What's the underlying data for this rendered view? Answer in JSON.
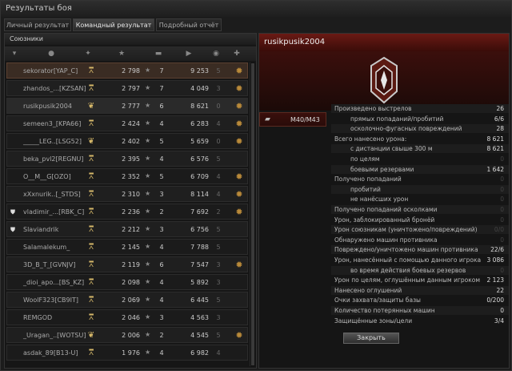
{
  "window": {
    "title": "Результаты боя"
  },
  "tabs": [
    {
      "label": "Личный результат"
    },
    {
      "label": "Командный результат"
    },
    {
      "label": "Подробный отчёт"
    }
  ],
  "team": {
    "title": "Союзники",
    "columns": [
      "rank-icon",
      "player-icon",
      "medal-icon",
      "xp-star-icon",
      "kills-icon",
      "damage-icon",
      "spot-icon",
      "badge-icon"
    ],
    "rows": [
      {
        "name": "sekorator[YAP_C]",
        "xp": "2 798",
        "kills": "7",
        "damage": "9 253",
        "spot": "5",
        "medal": "rank",
        "badge": true,
        "state": "selected"
      },
      {
        "name": "zhandos_...[KZSAN]",
        "xp": "2 797",
        "kills": "7",
        "damage": "4 049",
        "spot": "3",
        "medal": "rank",
        "badge": true,
        "state": ""
      },
      {
        "name": "rusikpusik2004",
        "xp": "2 777",
        "kills": "6",
        "damage": "8 621",
        "spot": "0",
        "medal": "wreath",
        "badge": true,
        "state": "me"
      },
      {
        "name": "semeen3_[KPA66]",
        "xp": "2 424",
        "kills": "4",
        "damage": "6 283",
        "spot": "4",
        "medal": "rank",
        "badge": true,
        "state": ""
      },
      {
        "name": "_____LEG..[LSG52]",
        "xp": "2 402",
        "kills": "5",
        "damage": "5 659",
        "spot": "0",
        "medal": "wreath",
        "badge": true,
        "state": ""
      },
      {
        "name": "beka_pvl2[REGNU]",
        "xp": "2 395",
        "kills": "4",
        "damage": "6 576",
        "spot": "5",
        "medal": "rank",
        "badge": false,
        "state": ""
      },
      {
        "name": "O__M__G[OZO]",
        "xp": "2 352",
        "kills": "5",
        "damage": "6 709",
        "spot": "4",
        "medal": "rank",
        "badge": true,
        "state": ""
      },
      {
        "name": "xXxnurik..[_STDS]",
        "xp": "2 310",
        "kills": "3",
        "damage": "8 114",
        "spot": "4",
        "medal": "rank",
        "badge": true,
        "state": ""
      },
      {
        "name": "vladimir_...[RBK_C]",
        "xp": "2 236",
        "kills": "2",
        "damage": "7 692",
        "spot": "2",
        "medal": "rank",
        "badge": true,
        "state": "",
        "tank": "shield"
      },
      {
        "name": "Slaviandrik",
        "xp": "2 212",
        "kills": "3",
        "damage": "6 756",
        "spot": "5",
        "medal": "rank",
        "badge": false,
        "state": "",
        "tank": "shield"
      },
      {
        "name": "Salamalekum_",
        "xp": "2 145",
        "kills": "4",
        "damage": "7 788",
        "spot": "5",
        "medal": "rank",
        "badge": false,
        "state": ""
      },
      {
        "name": "3D_B_T_[GVNJV]",
        "xp": "2 119",
        "kills": "6",
        "damage": "7 547",
        "spot": "3",
        "medal": "rank",
        "badge": true,
        "state": ""
      },
      {
        "name": "_dioi_apo...[BS_KZ]",
        "xp": "2 098",
        "kills": "4",
        "damage": "5 892",
        "spot": "3",
        "medal": "rank",
        "badge": false,
        "state": ""
      },
      {
        "name": "WoolF323[CB9IT]",
        "xp": "2 069",
        "kills": "4",
        "damage": "6 445",
        "spot": "5",
        "medal": "rank",
        "badge": false,
        "state": ""
      },
      {
        "name": "REMGOD",
        "xp": "2 046",
        "kills": "3",
        "damage": "4 563",
        "spot": "3",
        "medal": "rank",
        "badge": false,
        "state": ""
      },
      {
        "name": "_Uragan_..[WOTSU]",
        "xp": "2 006",
        "kills": "2",
        "damage": "4 545",
        "spot": "5",
        "medal": "wreath",
        "badge": true,
        "state": ""
      },
      {
        "name": "asdak_89[B13-U]",
        "xp": "1 976",
        "kills": "4",
        "damage": "6 982",
        "spot": "4",
        "medal": "rank",
        "badge": false,
        "state": ""
      }
    ]
  },
  "player": {
    "name": "rusikpusik2004",
    "vehicle": "M40/M43",
    "stats": [
      {
        "label": "Произведено выстрелов",
        "value": "26",
        "indent": 0,
        "dim": false
      },
      {
        "label": "прямых попаданий/пробитий",
        "value": "6/6",
        "indent": 1,
        "dim": false
      },
      {
        "label": "осколочно-фугасных повреждений",
        "value": "28",
        "indent": 1,
        "dim": false
      },
      {
        "label": "Всего нанесено урона:",
        "value": "8 621",
        "indent": 0,
        "dim": false
      },
      {
        "label": "с дистанции свыше 300 м",
        "value": "8 621",
        "indent": 1,
        "dim": false
      },
      {
        "label": "по целям",
        "value": "0",
        "indent": 1,
        "dim": true
      },
      {
        "label": "боевыми резервами",
        "value": "1 642",
        "indent": 1,
        "dim": false
      },
      {
        "label": "Получено попаданий",
        "value": "0",
        "indent": 0,
        "dim": true
      },
      {
        "label": "пробитий",
        "value": "0",
        "indent": 1,
        "dim": true
      },
      {
        "label": "не нанёсших урон",
        "value": "0",
        "indent": 1,
        "dim": true
      },
      {
        "label": "Получено попаданий осколками",
        "value": "0",
        "indent": 0,
        "dim": true
      },
      {
        "label": "Урон, заблокированный бронёй",
        "value": "0",
        "indent": 0,
        "dim": true
      },
      {
        "label": "Урон союзникам (уничтожено/повреждений)",
        "value": "0/0",
        "indent": 0,
        "dim": true
      },
      {
        "label": "Обнаружено машин противника",
        "value": "0",
        "indent": 0,
        "dim": true
      },
      {
        "label": "Повреждено/уничтожено машин противника",
        "value": "22/6",
        "indent": 0,
        "dim": false
      },
      {
        "label": "Урон, нанесённый с помощью данного игрока",
        "value": "3 086",
        "indent": 0,
        "dim": false
      },
      {
        "label": "во время действия боевых резервов",
        "value": "0",
        "indent": 1,
        "dim": true
      },
      {
        "label": "Урон по целям, оглушённым данным игроком",
        "value": "2 123",
        "indent": 0,
        "dim": false
      },
      {
        "label": "Нанесено оглушений",
        "value": "22",
        "indent": 0,
        "dim": false
      },
      {
        "label": "Очки захвата/защиты базы",
        "value": "0/200",
        "indent": 0,
        "dim": false
      },
      {
        "label": "Количество потерянных машин",
        "value": "0",
        "indent": 0,
        "dim": false
      },
      {
        "label": "Защищённые зоны/цели",
        "value": "3/4",
        "indent": 0,
        "dim": false
      }
    ],
    "close_label": "Закрыть"
  }
}
